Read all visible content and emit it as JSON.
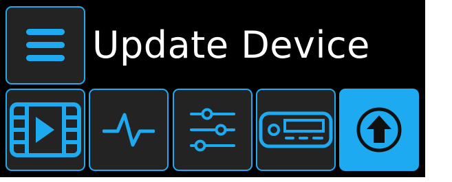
{
  "header": {
    "title": "Update Device",
    "menu_icon": "hamburger-menu-icon"
  },
  "tabs": [
    {
      "id": "media",
      "icon": "video-film-icon",
      "active": false
    },
    {
      "id": "signal",
      "icon": "pulse-waveform-icon",
      "active": false
    },
    {
      "id": "settings",
      "icon": "sliders-icon",
      "active": false
    },
    {
      "id": "device",
      "icon": "device-unit-icon",
      "active": false
    },
    {
      "id": "update",
      "icon": "upload-arrow-icon",
      "active": true
    }
  ],
  "colors": {
    "accent": "#1eaaf1",
    "background": "#000000",
    "panel": "#232323",
    "text": "#ffffff"
  }
}
